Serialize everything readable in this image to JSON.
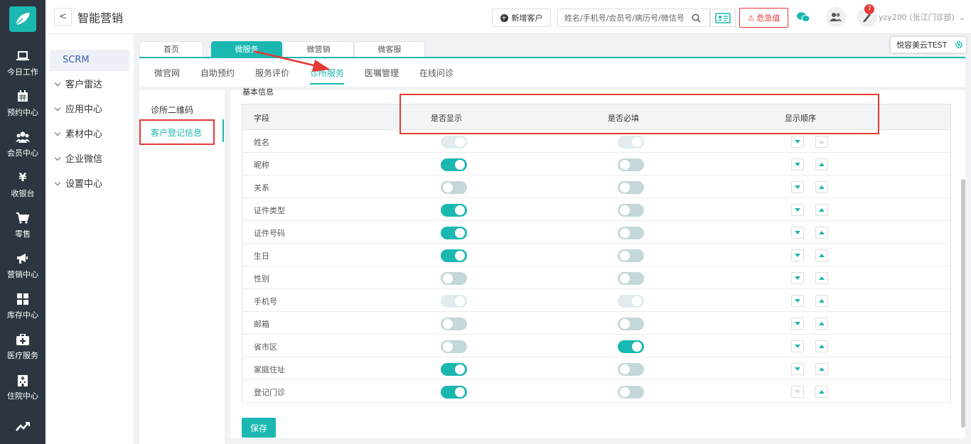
{
  "header": {
    "title": "智能营销",
    "back_label": "<",
    "new_customer": "新增客户",
    "search_placeholder": "姓名/手机号/会员号/病历号/微信号",
    "urgent": "危急值",
    "notification_count": "7",
    "user": "yzy200 (张江门诊部)",
    "store": "悦容美云TEST"
  },
  "left_nav": [
    {
      "label": "今日工作",
      "icon": "laptop-icon"
    },
    {
      "label": "预约中心",
      "icon": "calendar-icon"
    },
    {
      "label": "会员中心",
      "icon": "members-icon"
    },
    {
      "label": "收银台",
      "icon": "yen-icon"
    },
    {
      "label": "零售",
      "icon": "cart-icon"
    },
    {
      "label": "营销中心",
      "icon": "megaphone-icon"
    },
    {
      "label": "库存中心",
      "icon": "grid-icon"
    },
    {
      "label": "医疗服务",
      "icon": "medkit-icon"
    },
    {
      "label": "住院中心",
      "icon": "building-icon"
    },
    {
      "label": "",
      "icon": "chart-icon"
    }
  ],
  "side_menu": [
    {
      "label": "SCRM",
      "active": true
    },
    {
      "label": "客户雷达"
    },
    {
      "label": "应用中心"
    },
    {
      "label": "素材中心"
    },
    {
      "label": "企业微信"
    },
    {
      "label": "设置中心"
    }
  ],
  "tabs": [
    "首页",
    "微服务",
    "微营销",
    "微客服"
  ],
  "subnav": [
    "微官网",
    "自助预约",
    "服务评价",
    "诊所服务",
    "医嘱管理",
    "在线问诊"
  ],
  "inner_menu": [
    "诊所二维码",
    "客户登记信息"
  ],
  "section_title": "基本信息",
  "table": {
    "headers": [
      "字段",
      "是否显示",
      "是否必填",
      "显示顺序"
    ],
    "rows": [
      {
        "field": "姓名",
        "show": "disabled",
        "required": "disabled",
        "down": "on",
        "up": "disabled"
      },
      {
        "field": "昵称",
        "show": "on",
        "required": "off",
        "down": "on",
        "up": "on"
      },
      {
        "field": "关系",
        "show": "off",
        "required": "off",
        "down": "on",
        "up": "on"
      },
      {
        "field": "证件类型",
        "show": "on",
        "required": "off",
        "down": "on",
        "up": "on"
      },
      {
        "field": "证件号码",
        "show": "on",
        "required": "off",
        "down": "on",
        "up": "on"
      },
      {
        "field": "生日",
        "show": "on",
        "required": "off",
        "down": "on",
        "up": "on"
      },
      {
        "field": "性别",
        "show": "off",
        "required": "off",
        "down": "on",
        "up": "on"
      },
      {
        "field": "手机号",
        "show": "disabled",
        "required": "disabled",
        "down": "on",
        "up": "on"
      },
      {
        "field": "邮箱",
        "show": "off",
        "required": "off",
        "down": "on",
        "up": "on"
      },
      {
        "field": "省市区",
        "show": "off",
        "required": "on",
        "down": "on",
        "up": "on"
      },
      {
        "field": "家庭住址",
        "show": "on",
        "required": "off",
        "down": "on",
        "up": "on"
      },
      {
        "field": "登记门诊",
        "show": "on",
        "required": "off",
        "down": "disabled",
        "up": "on"
      }
    ]
  },
  "save_label": "保存",
  "colors": {
    "accent": "#1ab8b0",
    "sidebar": "#2d3640",
    "highlight": "#e53935"
  }
}
